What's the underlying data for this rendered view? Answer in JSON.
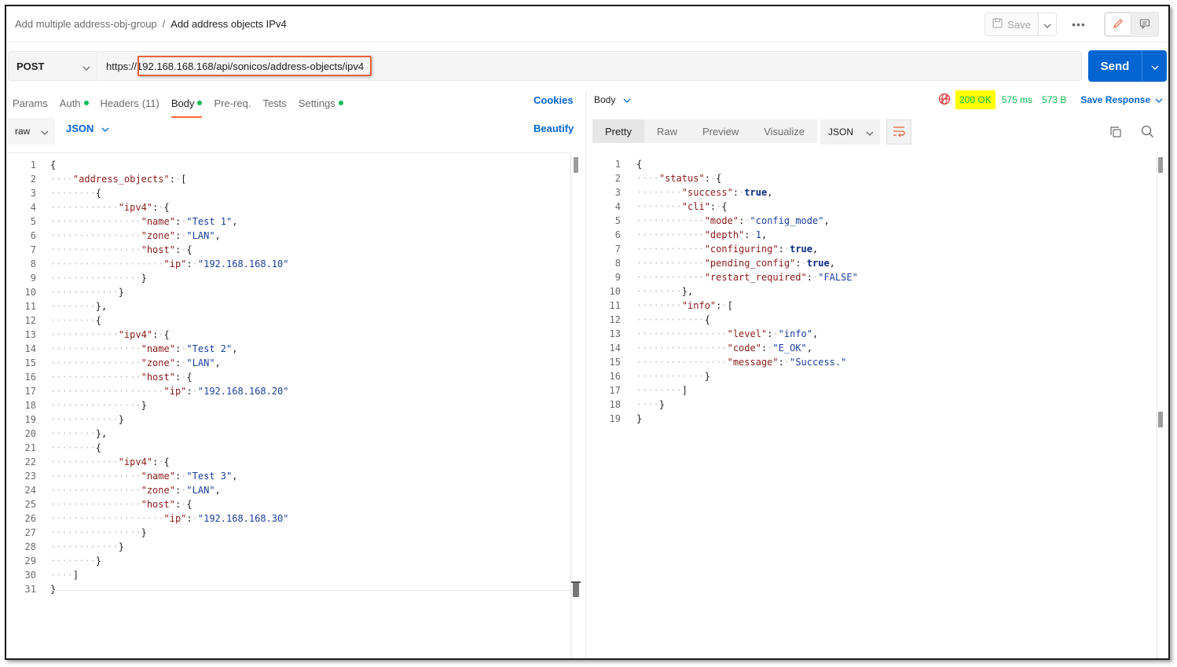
{
  "header": {
    "breadcrumb_parent": "Add multiple address-obj-group",
    "breadcrumb_sep": "/",
    "breadcrumb_current": "Add address objects IPv4",
    "save_label": "Save",
    "more_label": "•••"
  },
  "request": {
    "method": "POST",
    "url_prefix": "https://",
    "url_rest": "192.168.168.168/api/sonicos/address-objects/ipv4",
    "send_label": "Send",
    "tabs": {
      "params": "Params",
      "auth": "Auth",
      "headers": "Headers",
      "headers_count": "(11)",
      "body": "Body",
      "prereq": "Pre-req.",
      "tests": "Tests",
      "settings": "Settings"
    },
    "cookies_label": "Cookies",
    "body_mode": "raw",
    "body_lang": "JSON",
    "beautify_label": "Beautify",
    "body_lines": [
      "{",
      "    \"address_objects\": [",
      "        {",
      "            \"ipv4\": {",
      "                \"name\": \"Test 1\",",
      "                \"zone\": \"LAN\",",
      "                \"host\": {",
      "                    \"ip\": \"192.168.168.10\"",
      "                }",
      "            }",
      "        },",
      "        {",
      "            \"ipv4\": {",
      "                \"name\": \"Test 2\",",
      "                \"zone\": \"LAN\",",
      "                \"host\": {",
      "                    \"ip\": \"192.168.168.20\"",
      "                }",
      "            }",
      "        },",
      "        {",
      "            \"ipv4\": {",
      "                \"name\": \"Test 3\",",
      "                \"zone\": \"LAN\",",
      "                \"host\": {",
      "                    \"ip\": \"192.168.168.30\"",
      "                }",
      "            }",
      "        }",
      "    ]",
      "}"
    ]
  },
  "response": {
    "section_label": "Body",
    "status": "200 OK",
    "time": "575 ms",
    "size": "573 B",
    "save_response_label": "Save Response",
    "tabs": {
      "pretty": "Pretty",
      "raw": "Raw",
      "preview": "Preview",
      "visualize": "Visualize"
    },
    "lang": "JSON",
    "body_lines": [
      "{",
      "    \"status\": {",
      "        \"success\": true,",
      "        \"cli\": {",
      "            \"mode\": \"config_mode\",",
      "            \"depth\": 1,",
      "            \"configuring\": true,",
      "            \"pending_config\": true,",
      "            \"restart_required\": \"FALSE\"",
      "        },",
      "        \"info\": [",
      "            {",
      "                \"level\": \"info\",",
      "                \"code\": \"E_OK\",",
      "                \"message\": \"Success.\"",
      "            }",
      "        ]",
      "    }",
      "}"
    ]
  },
  "colors": {
    "accent_blue": "#0265d2",
    "tab_indicator": "#ff6c37",
    "status_green": "#0cbb52",
    "highlight_box": "#e8643b",
    "status_highlight": "#ffff00"
  }
}
